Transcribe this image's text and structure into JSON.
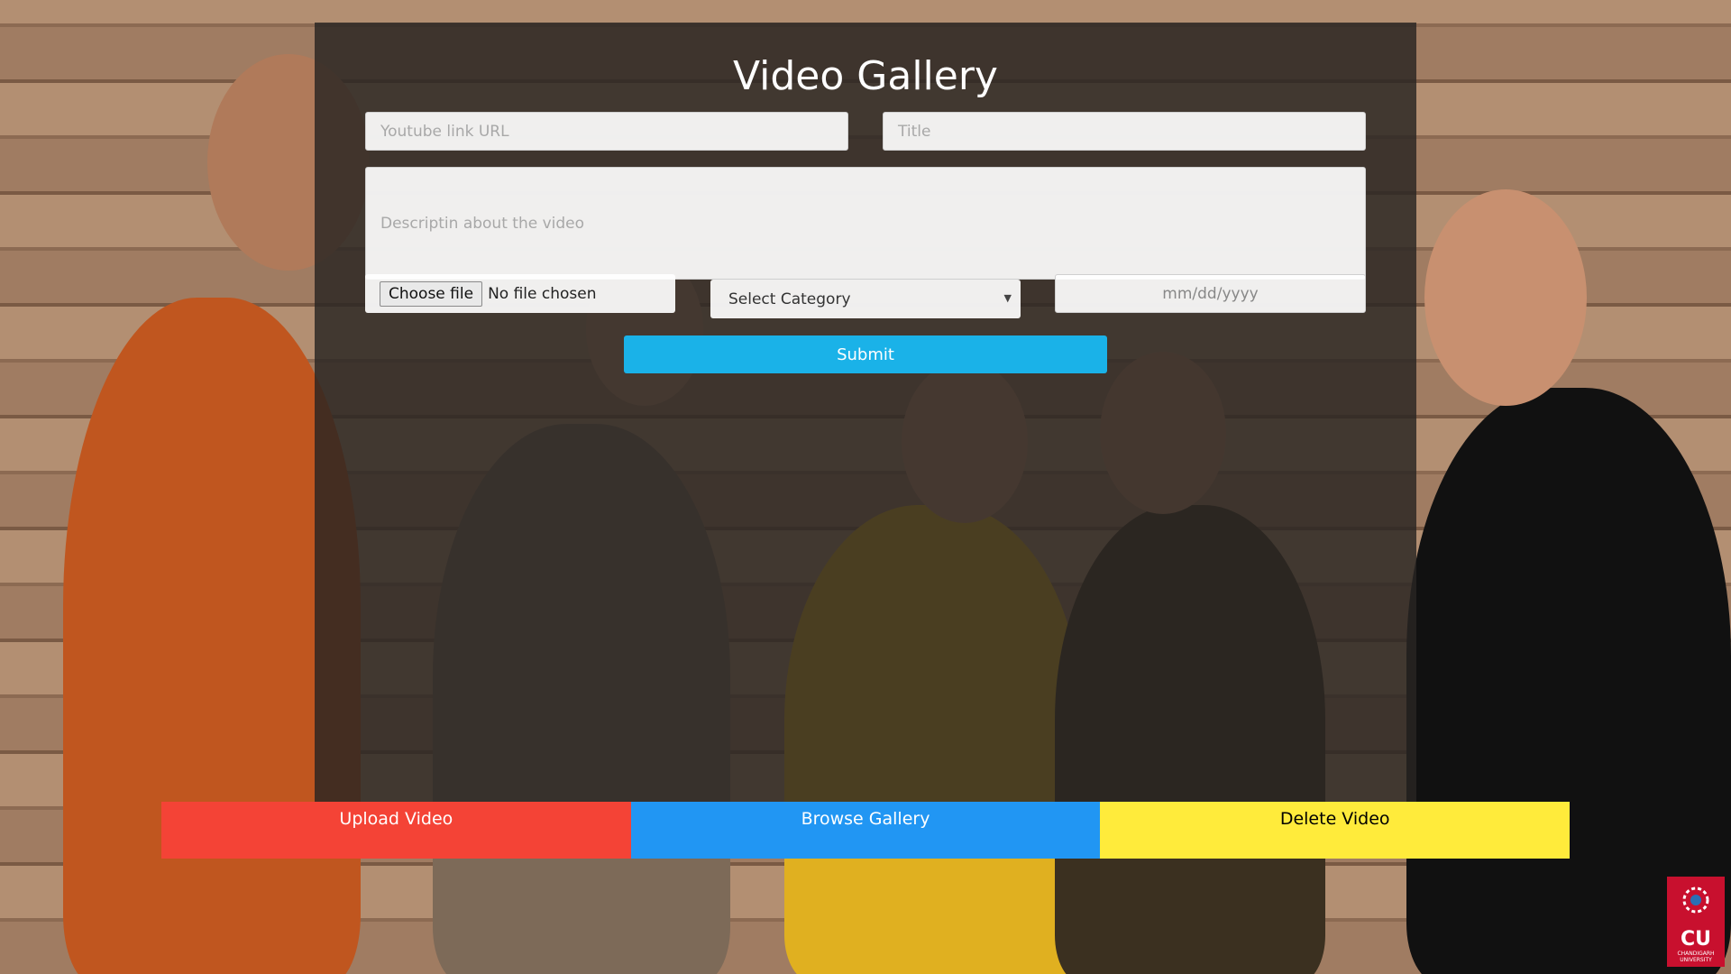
{
  "page": {
    "title": "Video Gallery"
  },
  "form": {
    "youtube_placeholder": "Youtube link URL",
    "title_placeholder": "Title",
    "description_placeholder": "Descriptin about the video",
    "file_button": "Choose file",
    "file_status": "No file chosen",
    "category_selected": "Select Category",
    "date_placeholder": "mm/dd/yyyy",
    "submit_label": "Submit"
  },
  "tabs": [
    {
      "label": "Upload Video",
      "color": "#f44336",
      "text_color": "#ffffff"
    },
    {
      "label": "Browse Gallery",
      "color": "#2196f3",
      "text_color": "#ffffff"
    },
    {
      "label": "Delete Video",
      "color": "#ffeb3b",
      "text_color": "#000000"
    }
  ],
  "logo": {
    "initials": "CU",
    "name": "CHANDIGARH UNIVERSITY"
  },
  "colors": {
    "submit": "#1ab2e8",
    "panel": "rgba(40,36,34,0.82)"
  }
}
